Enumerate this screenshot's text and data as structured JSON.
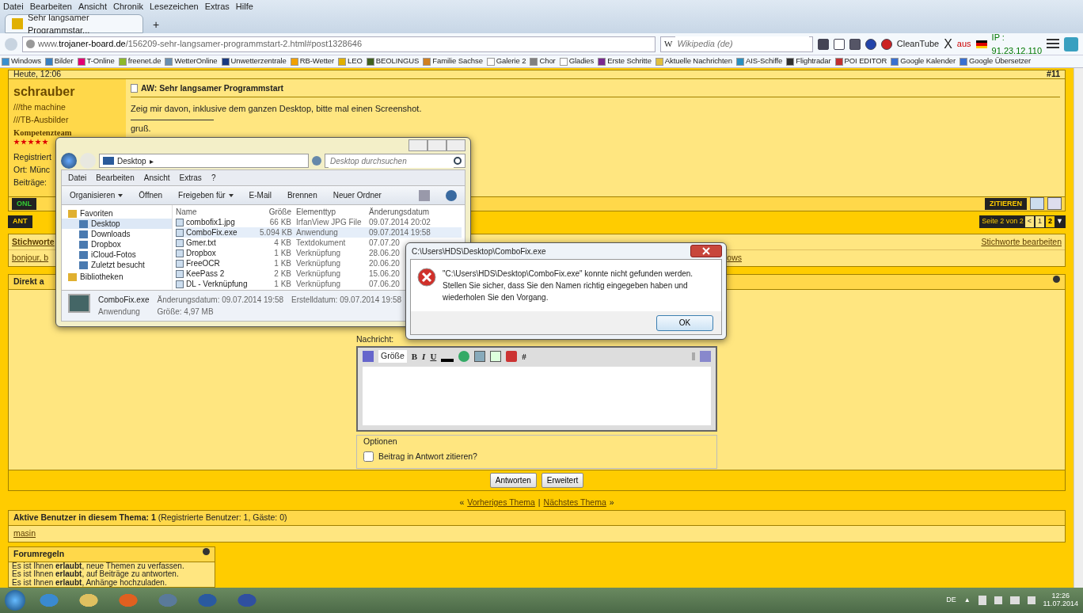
{
  "menu": [
    "Datei",
    "Bearbeiten",
    "Ansicht",
    "Chronik",
    "Lesezeichen",
    "Extras",
    "Hilfe"
  ],
  "tabs": [
    {
      "label": "Sehr langsamer Programmstar...",
      "selected": true
    }
  ],
  "new_tab": "+",
  "url": "www.**trojaner-board.de**/156209-sehr-langsamer-programmstart-2.html#post1328646",
  "search": {
    "engine": "W",
    "placeholder": "Wikipedia (de)"
  },
  "toolbar": {
    "cleantube": "CleanTube",
    "x_button": "X",
    "status": "aus",
    "ip": "IP : 91.23.12.110"
  },
  "bookmarks": [
    {
      "label": "Windows",
      "color": "#3a8fd0"
    },
    {
      "label": "Bilder",
      "color": "#3a7fc0"
    },
    {
      "label": "T-Online",
      "color": "#e20074"
    },
    {
      "label": "freenet.de",
      "color": "#8cb82c"
    },
    {
      "label": "WetterOnline",
      "color": "#6a8fb0"
    },
    {
      "label": "Unwetterzentrale",
      "color": "#1a3a80"
    },
    {
      "label": "RB-Wetter",
      "color": "#f0a000"
    },
    {
      "label": "LEO",
      "color": "#e0b000"
    },
    {
      "label": "BEOLINGUS",
      "color": "#406020"
    },
    {
      "label": "Familie Sachse",
      "color": "#d08020"
    },
    {
      "label": "Galerie 2",
      "color": "#ffffff"
    },
    {
      "label": "Chor",
      "color": "#808080"
    },
    {
      "label": "Gladies",
      "color": "#ffffff"
    },
    {
      "label": "Erste Schritte",
      "color": "#7a2a90"
    },
    {
      "label": "Aktuelle Nachrichten",
      "color": "#e0c040"
    },
    {
      "label": "AIS-Schiffe",
      "color": "#2a90c0"
    },
    {
      "label": "Flightradar",
      "color": "#303030"
    },
    {
      "label": "POI EDITOR",
      "color": "#c03030"
    },
    {
      "label": "Google Kalender",
      "color": "#3a70d0"
    },
    {
      "label": "Google Übersetzer",
      "color": "#3a70d0"
    }
  ],
  "post": {
    "date": "Heute, 12:06",
    "number": "#11",
    "user": {
      "name": "schrauber",
      "titles": [
        "///the machine",
        "///TB-Ausbilder",
        "Kompetenzteam"
      ],
      "stars": 5,
      "info": [
        "Registriert",
        "Ort: Münc",
        "Beiträge:"
      ]
    },
    "title": "AW: Sehr langsamer Programmstart",
    "text": "Zeig mir davon, inklusive dem ganzen Desktop, bitte mal einen Screenshot.",
    "signature": "gruß.",
    "online": "ONL",
    "quote": "ZITIEREN"
  },
  "reply_button": "ANT",
  "pagination": {
    "label": "Seite 2 von 2",
    "prev": "<",
    "pages": [
      {
        "label": "1",
        "selected": false
      },
      {
        "label": "2",
        "selected": true
      }
    ],
    "menu": "▼"
  },
  "tags": {
    "title": "Stichworte",
    "edit": "Stichworte bearbeiten",
    "items": [
      "bonjour, b",
      "ows"
    ]
  },
  "quick_reply": {
    "title": "Direkt a",
    "message_label": "Nachricht:",
    "size_select": "Größe",
    "format": [
      "B",
      "I",
      "U"
    ],
    "hash": "#",
    "options_legend": "Optionen",
    "quote_checkbox": {
      "label": "Beitrag in Antwort zitieren?",
      "checked": false
    },
    "buttons": [
      "Antworten",
      "Erweitert"
    ]
  },
  "thread_nav": {
    "prev_mark": "«",
    "prev": "Vorheriges Thema",
    "sep": "|",
    "next": "Nächstes Thema",
    "next_mark": "»"
  },
  "active_users": {
    "title": "**Aktive Benutzer in diesem Thema: 1** (Registrierte Benutzer: 1, Gäste: 0)",
    "users": [
      "masin"
    ]
  },
  "forum_rules": {
    "title": "Forumregeln",
    "lines": [
      "Es ist Ihnen **erlaubt**, neue Themen zu verfassen.",
      "Es ist Ihnen **erlaubt**, auf Beiträge zu antworten.",
      "Es ist Ihnen **erlaubt**, Anhänge hochzuladen."
    ]
  },
  "explorer": {
    "location": "Desktop",
    "location_arrow": "▸",
    "search_placeholder": "Desktop durchsuchen",
    "menu": [
      "Datei",
      "Bearbeiten",
      "Ansicht",
      "Extras",
      "?"
    ],
    "commands": [
      {
        "label": "Organisieren",
        "dropdown": true
      },
      {
        "label": "Öffnen",
        "dropdown": false
      },
      {
        "label": "Freigeben für",
        "dropdown": true
      },
      {
        "label": "E-Mail",
        "dropdown": false
      },
      {
        "label": "Brennen",
        "dropdown": false
      },
      {
        "label": "Neuer Ordner",
        "dropdown": false
      }
    ],
    "nav": [
      {
        "label": "Favoriten",
        "kind": "header",
        "selected": false
      },
      {
        "label": "Desktop",
        "kind": "item",
        "selected": true
      },
      {
        "label": "Downloads",
        "kind": "item",
        "selected": false
      },
      {
        "label": "Dropbox",
        "kind": "item",
        "selected": false
      },
      {
        "label": "iCloud-Fotos",
        "kind": "item",
        "selected": false
      },
      {
        "label": "Zuletzt besucht",
        "kind": "item",
        "selected": false
      },
      {
        "label": "Bibliotheken",
        "kind": "header",
        "selected": false
      }
    ],
    "columns": [
      "Name",
      "Größe",
      "Elementtyp",
      "Änderungsdatum"
    ],
    "files": [
      {
        "name": "combofix1.jpg",
        "size": "66 KB",
        "type": "IrfanView JPG File",
        "date": "09.07.2014 20:02",
        "selected": false
      },
      {
        "name": "ComboFix.exe",
        "size": "5.094 KB",
        "type": "Anwendung",
        "date": "09.07.2014 19:58",
        "selected": true
      },
      {
        "name": "Gmer.txt",
        "size": "4 KB",
        "type": "Textdokument",
        "date": "07.07.20",
        "selected": false
      },
      {
        "name": "Dropbox",
        "size": "1 KB",
        "type": "Verknüpfung",
        "date": "28.06.20",
        "selected": false
      },
      {
        "name": "FreeOCR",
        "size": "1 KB",
        "type": "Verknüpfung",
        "date": "20.06.20",
        "selected": false
      },
      {
        "name": "KeePass 2",
        "size": "2 KB",
        "type": "Verknüpfung",
        "date": "15.06.20",
        "selected": false
      },
      {
        "name": "DL - Verknüpfung",
        "size": "1 KB",
        "type": "Verknüpfung",
        "date": "07.06.20",
        "selected": false
      }
    ],
    "details": {
      "name": "ComboFix.exe",
      "modified": "Änderungsdatum: 09.07.2014 19:58",
      "created": "Erstelldatum: 09.07.2014 19:58",
      "type": "Anwendung",
      "size": "Größe: 4,97 MB"
    }
  },
  "error_dialog": {
    "title": "C:\\Users\\HDS\\Desktop\\ComboFix.exe",
    "message": "\"C:\\Users\\HDS\\Desktop\\ComboFix.exe\" konnte nicht gefunden werden. Stellen Sie sicher, dass Sie den Namen richtig eingegeben haben und wiederholen Sie den Vorgang.",
    "ok": "OK"
  },
  "taskbar": {
    "language": "DE",
    "tray_arrow": "▲",
    "time": "12:26",
    "date": "11.07.2014"
  }
}
